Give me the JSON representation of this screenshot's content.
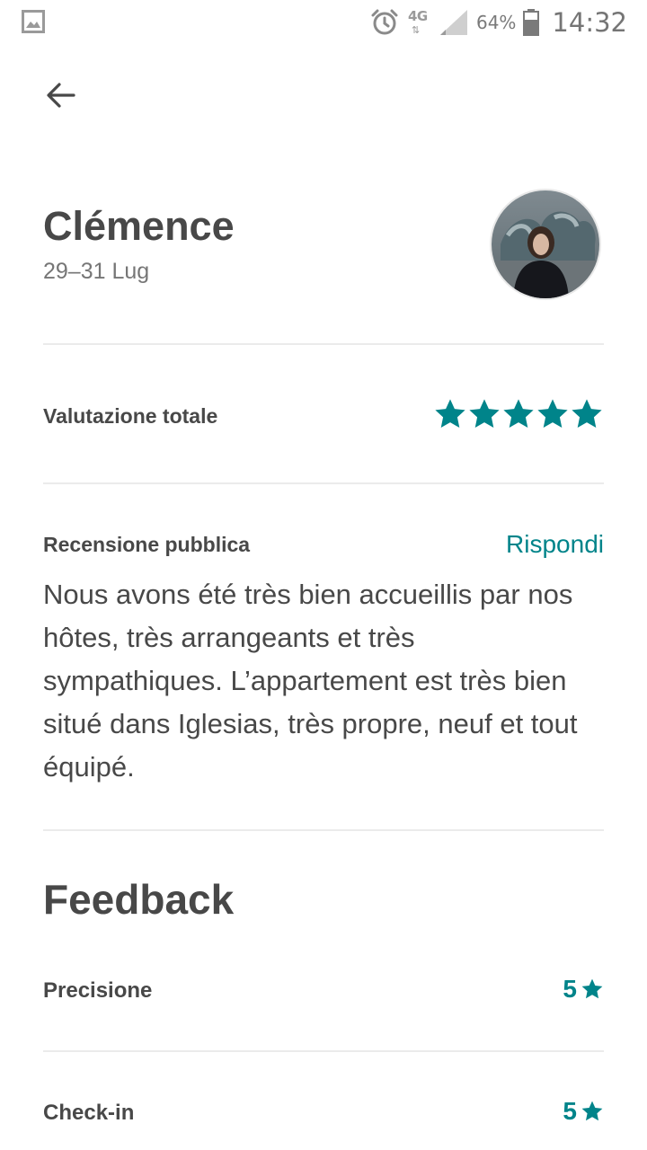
{
  "status_bar": {
    "network": "4G",
    "network_arrows": "⇅",
    "battery": "64%",
    "time": "14:32",
    "icons": [
      "gallery-icon",
      "alarm-icon",
      "signal-icon",
      "battery-icon"
    ]
  },
  "header": {
    "name": "Clémence",
    "dates": "29–31 Lug"
  },
  "overall": {
    "label": "Valutazione totale",
    "rating": 5,
    "max": 5
  },
  "review": {
    "label": "Recensione pubblica",
    "reply": "Rispondi",
    "text": "Nous avons été très bien accueillis par nos hôtes, très arrangeants et très sympathiques. L’appartement est très bien situé dans Iglesias, très propre, neuf et tout équipé."
  },
  "feedback": {
    "title": "Feedback",
    "items": [
      {
        "label": "Precisione",
        "score": "5"
      },
      {
        "label": "Check-in",
        "score": "5"
      }
    ]
  },
  "colors": {
    "accent": "#00848a",
    "text": "#484848",
    "muted": "#767676",
    "divider": "#ebebeb"
  }
}
